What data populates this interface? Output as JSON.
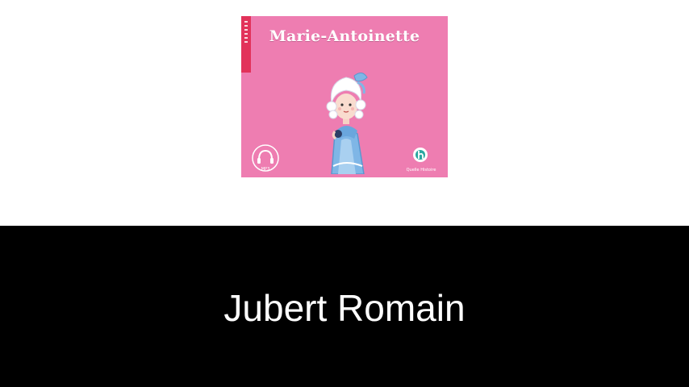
{
  "book": {
    "cover_title": "Marie-Antoinette",
    "audio_badge_icon": "headphones-icon",
    "audio_badge_text": "MP3",
    "publisher_icon": "quelle-histoire-logo-icon",
    "publisher_name": "Quelle Histoire",
    "cover_color": "#ee7db1",
    "spine_color": "#e2325a"
  },
  "author": {
    "name": "Jubert Romain"
  },
  "colors": {
    "top_background": "#ffffff",
    "bottom_band": "#000000",
    "author_text": "#ffffff"
  }
}
